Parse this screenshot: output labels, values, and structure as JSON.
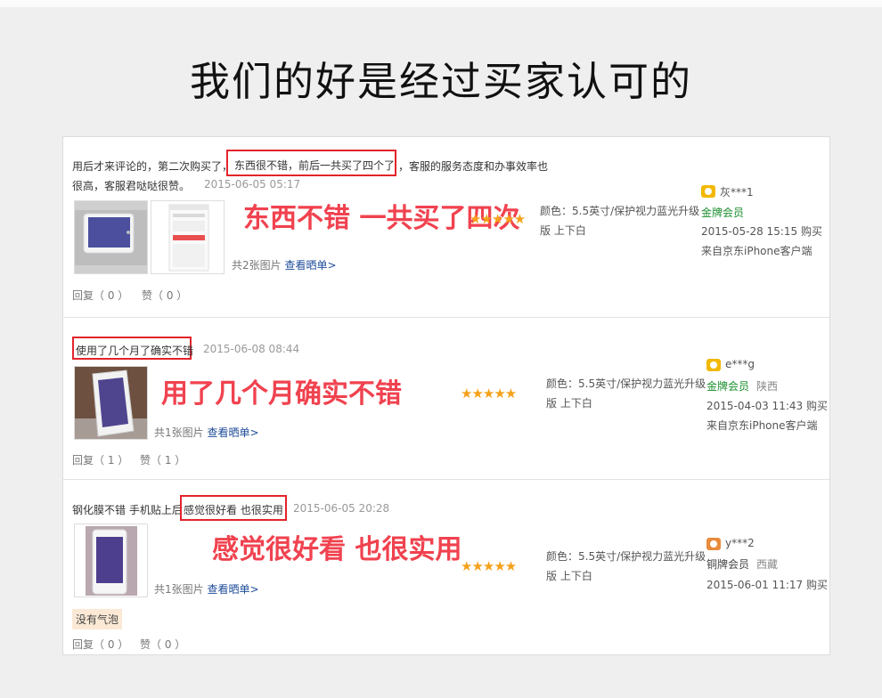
{
  "title": "我们的好是经过买家认可的",
  "link_view": "查看晒单>",
  "reviews": [
    {
      "text_a": "用后才来评论的，第二次购买了，",
      "text_hl": "东西很不错，前后一共买了四个了",
      "text_b": "，客服的服务态度和办事效率也",
      "text_line2": "很高，客服君哒哒很赞。",
      "date": "2015-06-05 05:17",
      "overlay": "东西不错 一共买了四次",
      "pic_count": "共2张图片",
      "stars": 5,
      "spec_line1": "颜色：5.5英寸/保护视力蓝光升级",
      "spec_line2": "版 上下白",
      "user": "灰***1",
      "member": "金牌会员",
      "region": "",
      "buy_time": "2015-05-28 15:15 购买",
      "source": "来自京东iPhone客户端",
      "reply": "回复（ 0 ）",
      "like": "赞（ 0 ）"
    },
    {
      "text_hl": "使用了几个月了确实不错",
      "date": "2015-06-08 08:44",
      "overlay": "用了几个月确实不错",
      "pic_count": "共1张图片",
      "stars": 5,
      "spec_line1": "颜色：5.5英寸/保护视力蓝光升级",
      "spec_line2": "版 上下白",
      "user": "e***g",
      "member": "金牌会员",
      "region": "陕西",
      "buy_time": "2015-04-03 11:43 购买",
      "source": "来自京东iPhone客户端",
      "reply": "回复（ 1 ）",
      "like": "赞（ 1 ）"
    },
    {
      "text_a": "钢化膜不错 手机贴上后",
      "text_hl": "感觉很好看 也很实用",
      "date": "2015-06-05 20:28",
      "overlay": "感觉很好看 也很实用",
      "pic_count": "共1张图片",
      "stars": 5,
      "spec_line1": "颜色：5.5英寸/保护视力蓝光升级",
      "spec_line2": "版 上下白",
      "user": "y***2",
      "member": "铜牌会员",
      "region": "西藏",
      "buy_time": "2015-06-01 11:17 购买",
      "tag": "没有气泡",
      "reply": "回复（ 0 ）",
      "like": "赞（ 0 ）"
    }
  ]
}
